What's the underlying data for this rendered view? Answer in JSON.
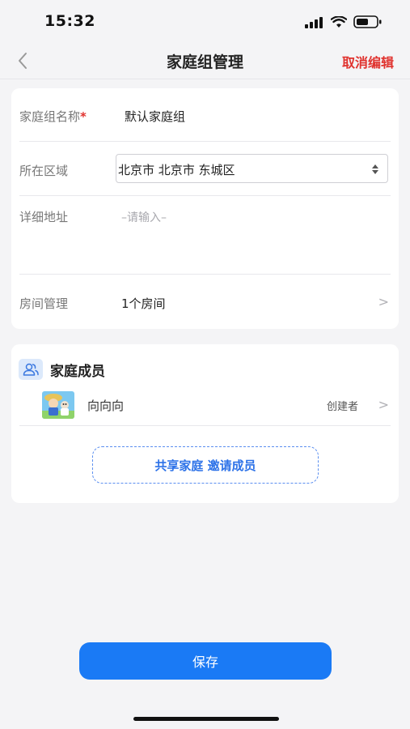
{
  "status_bar": {
    "time": "15:32",
    "icons": [
      "signal-icon",
      "wifi-icon",
      "battery-icon"
    ]
  },
  "nav": {
    "title": "家庭组管理",
    "action": "取消编辑",
    "action_color": "#e0322e",
    "back_icon": "chevron-left-icon"
  },
  "form": {
    "name_label": "家庭组名称",
    "required_mark": "*",
    "name_value": "默认家庭组",
    "region_label": "所在区域",
    "region_value": "北京市 北京市 东城区",
    "address_label": "详细地址",
    "address_placeholder": "–请输入–",
    "rooms_label": "房间管理",
    "rooms_value": "1个房间",
    "chevron": ">"
  },
  "members": {
    "title": "家庭成员",
    "title_icon": "people-icon",
    "list": [
      {
        "name": "向向向",
        "role": "创建者",
        "chevron": ">"
      }
    ],
    "invite_label": "共享家庭 邀请成员"
  },
  "footer": {
    "save_label": "保存",
    "accent": "#1a7af5"
  }
}
